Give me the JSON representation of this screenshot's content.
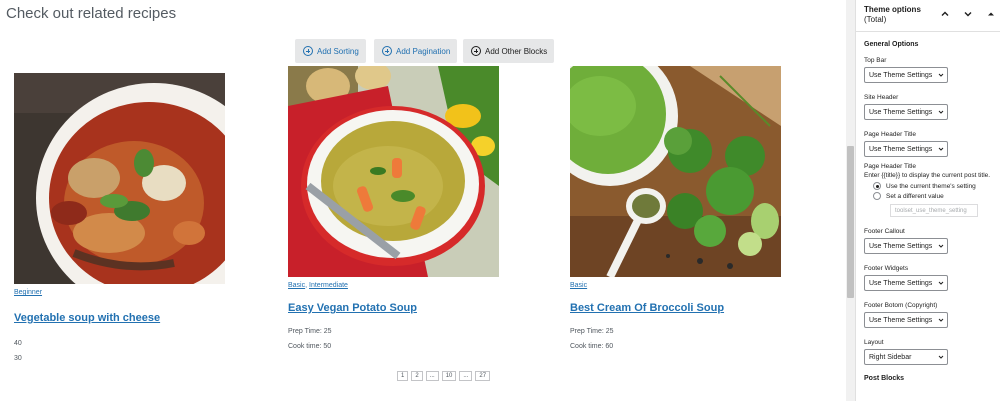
{
  "main": {
    "heading": "Check out related recipes",
    "toolbar": {
      "add_sorting": "Add Sorting",
      "add_pagination": "Add Pagination",
      "add_other_blocks": "Add Other Blocks"
    },
    "cards": [
      {
        "categories": [
          "Beginner"
        ],
        "title": "Vegetable soup with cheese",
        "meta": [
          "40",
          "30"
        ]
      },
      {
        "categories": [
          "Basic",
          "Intermediate"
        ],
        "title": "Easy Vegan Potato Soup",
        "meta": [
          "Prep Time: 25",
          "Cook time: 50"
        ]
      },
      {
        "categories": [
          "Basic"
        ],
        "title": "Best Cream Of Broccoli Soup",
        "meta": [
          "Prep Time: 25",
          "Cook time: 60"
        ]
      }
    ],
    "pagination": [
      "1",
      "2",
      "...",
      "10",
      "...",
      "27"
    ]
  },
  "sidebar": {
    "title": "Theme options",
    "subtitle": "(Total)",
    "section_title": "General Options",
    "fields": {
      "top_bar": {
        "label": "Top Bar",
        "value": "Use Theme Settings"
      },
      "site_header": {
        "label": "Site Header",
        "value": "Use Theme Settings"
      },
      "page_header_title_select": {
        "label": "Page Header Title",
        "value": "Use Theme Settings"
      },
      "page_header_title_text": {
        "label": "Page Header Title",
        "help": "Enter {{title}} to display the current post title.",
        "option_current": "Use the current theme's setting",
        "option_different": "Set a different value",
        "input_value": "toolset_use_theme_setting"
      },
      "footer_callout": {
        "label": "Footer Callout",
        "value": "Use Theme Settings"
      },
      "footer_widgets": {
        "label": "Footer Widgets",
        "value": "Use Theme Settings"
      },
      "footer_bottom": {
        "label": "Footer Botom (Copyright)",
        "value": "Use Theme Settings"
      },
      "layout": {
        "label": "Layout",
        "value": "Right Sidebar"
      }
    },
    "bottom_section": "Post Blocks"
  },
  "colors": {
    "link": "#2271b1",
    "button_bg": "#e6e7e8"
  }
}
